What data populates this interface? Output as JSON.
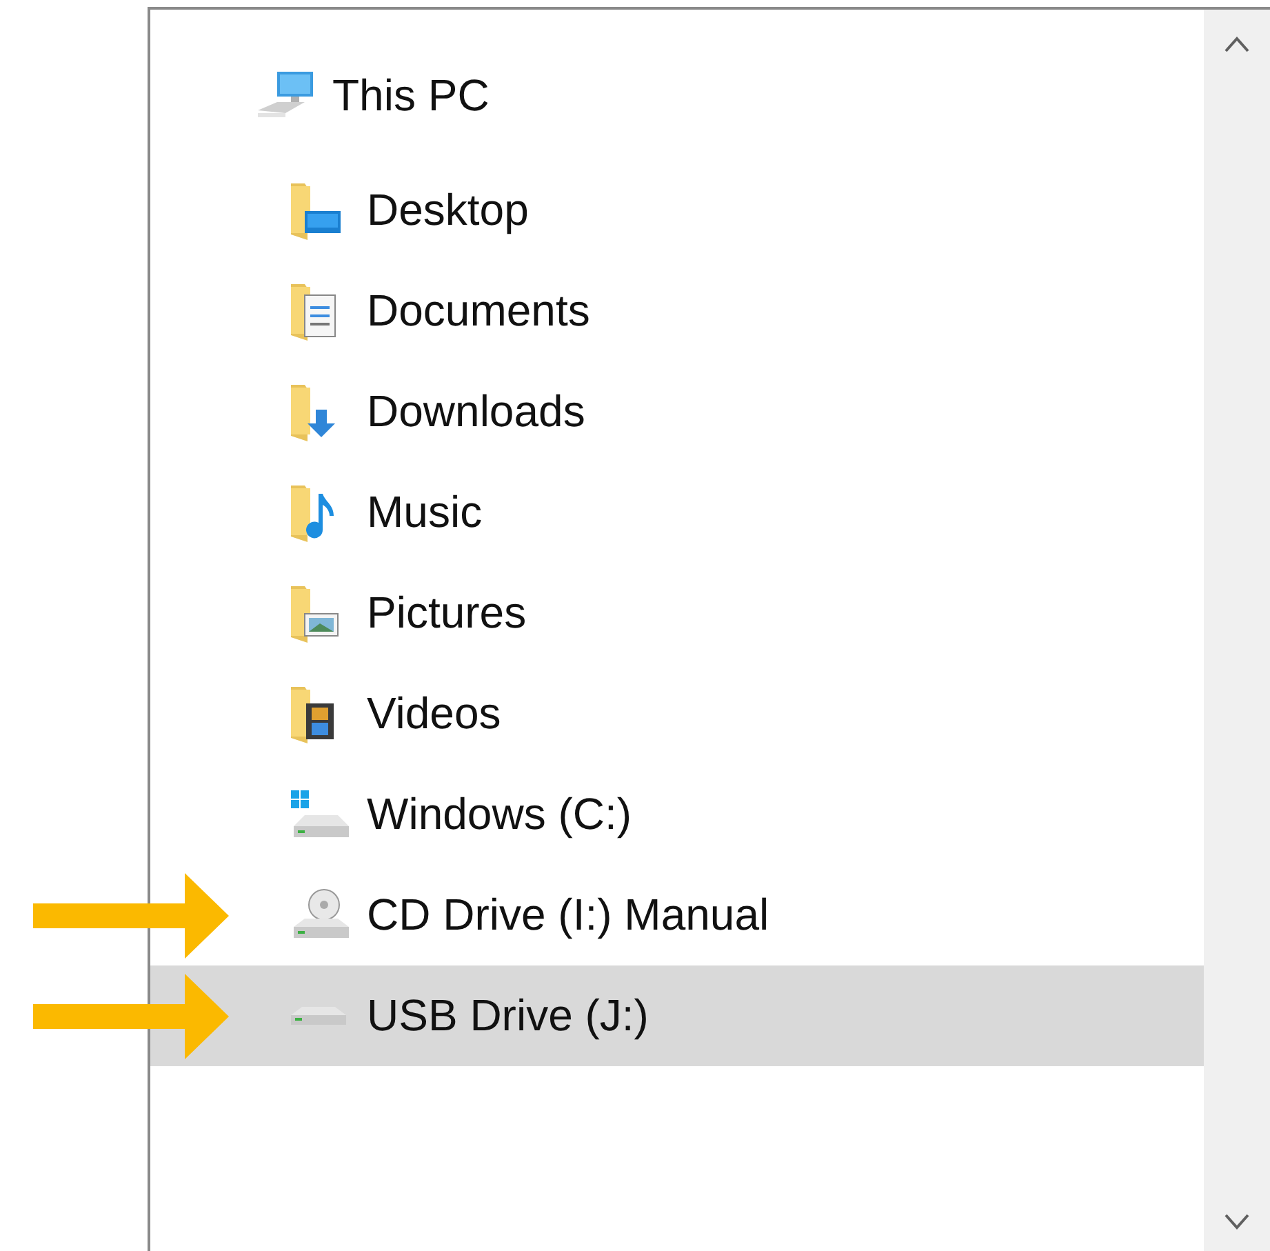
{
  "tree": {
    "label": "This PC",
    "kind": "computer",
    "selected": false,
    "arrow": false,
    "children": [
      {
        "label": "Desktop",
        "kind": "desktop",
        "selected": false,
        "arrow": false
      },
      {
        "label": "Documents",
        "kind": "documents",
        "selected": false,
        "arrow": false
      },
      {
        "label": "Downloads",
        "kind": "downloads",
        "selected": false,
        "arrow": false
      },
      {
        "label": "Music",
        "kind": "music",
        "selected": false,
        "arrow": false
      },
      {
        "label": "Pictures",
        "kind": "pictures",
        "selected": false,
        "arrow": false
      },
      {
        "label": "Videos",
        "kind": "videos",
        "selected": false,
        "arrow": false
      },
      {
        "label": "Windows (C:)",
        "kind": "system",
        "selected": false,
        "arrow": false
      },
      {
        "label": "CD Drive (I:) Manual",
        "kind": "disc",
        "selected": false,
        "arrow": true
      },
      {
        "label": "USB Drive (J:)",
        "kind": "removable",
        "selected": true,
        "arrow": true
      }
    ]
  }
}
